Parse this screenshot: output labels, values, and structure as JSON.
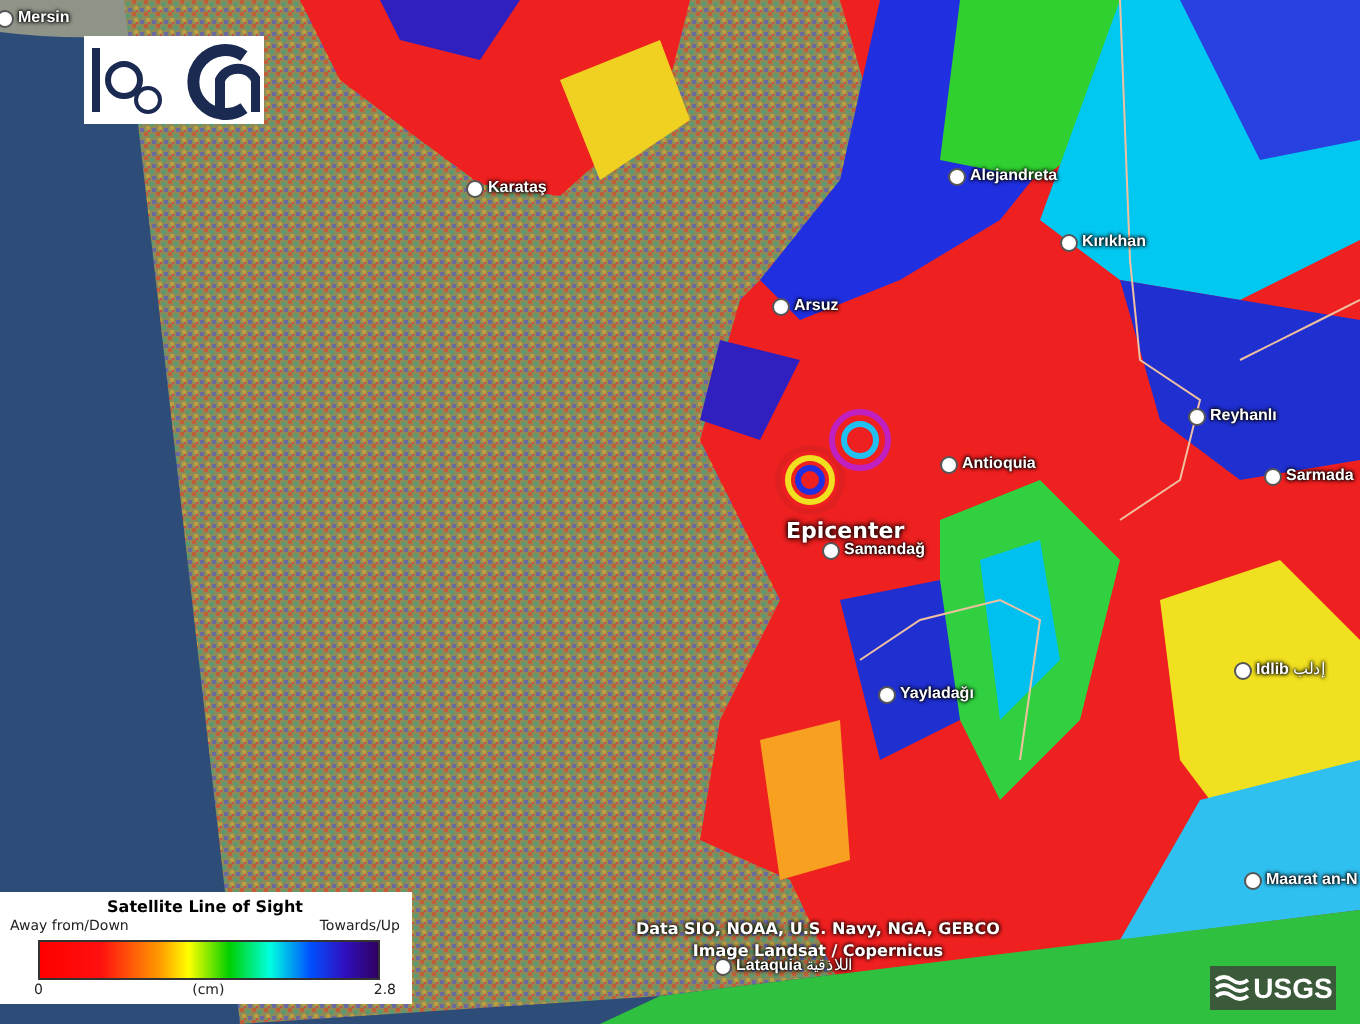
{
  "map": {
    "places": [
      {
        "name": "Mersin",
        "kind": "city"
      },
      {
        "name": "Karataş",
        "kind": "city"
      },
      {
        "name": "Alejandreta",
        "kind": "city"
      },
      {
        "name": "Kırıkhan",
        "kind": "city"
      },
      {
        "name": "Arsuz",
        "kind": "city"
      },
      {
        "name": "Reyhanlı",
        "kind": "city"
      },
      {
        "name": "Antioquia",
        "kind": "city"
      },
      {
        "name": "Sarmada",
        "kind": "city"
      },
      {
        "name": "Epicenter",
        "kind": "marker"
      },
      {
        "name": "Samandağ",
        "kind": "city"
      },
      {
        "name": "Yayladağı",
        "kind": "city"
      },
      {
        "name": "Idlib",
        "native_name": "إدلب",
        "kind": "city"
      },
      {
        "name": "Maarat an-N",
        "kind": "city"
      },
      {
        "name": "Lataquia",
        "native_name": "اللاذقية",
        "kind": "city"
      }
    ],
    "attribution": [
      "Data SIO, NOAA, U.S. Navy, NGA, GEBCO",
      "Image Landsat / Copernicus"
    ]
  },
  "legend": {
    "title": "Satellite Line of Sight",
    "left_label": "Away from/Down",
    "right_label": "Towards/Up",
    "min": "0",
    "unit": "(cm)",
    "max": "2.8"
  },
  "usgs_logo": {
    "text": "USGS"
  }
}
